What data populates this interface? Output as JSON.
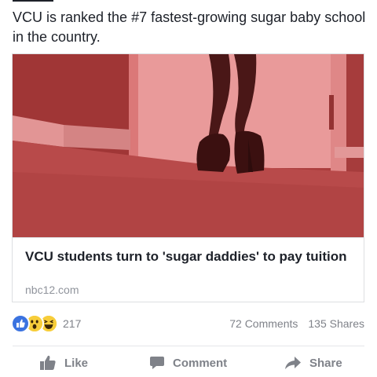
{
  "post": {
    "text": "VCU is ranked the #7 fastest-growing sugar baby school in the country."
  },
  "link_card": {
    "title": "VCU students turn to 'sugar daddies' to pay tuition",
    "domain": "nbc12.com",
    "image_icon": "photo-high-heels-on-carpet"
  },
  "reactions": {
    "icons": [
      "like-reaction-icon",
      "wow-reaction-icon",
      "haha-reaction-icon"
    ],
    "count": "217"
  },
  "stats": {
    "comments": "72 Comments",
    "shares": "135 Shares"
  },
  "actions": {
    "like": "Like",
    "comment": "Comment",
    "share": "Share"
  },
  "colors": {
    "like_blue": "#3b73e0",
    "emoji_yellow": "#f7cd3a",
    "muted_text": "#7f8289",
    "image_tint": "#c04848"
  }
}
